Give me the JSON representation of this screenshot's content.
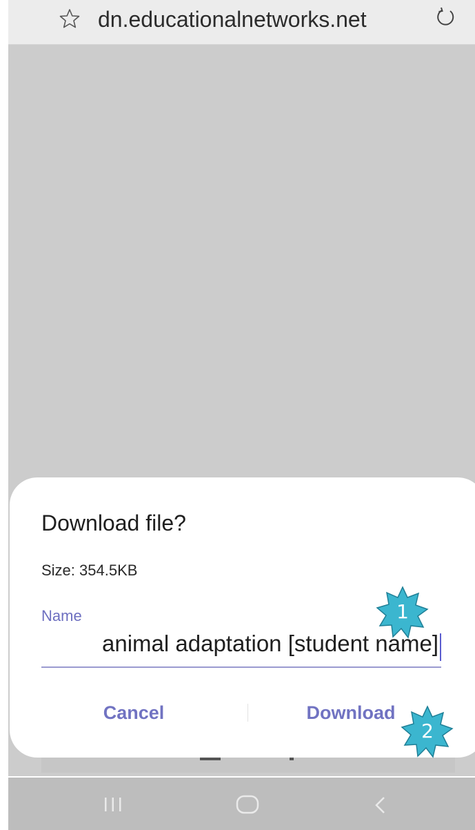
{
  "browser": {
    "url": "dn.educationalnetworks.net",
    "icons": {
      "bookmark": "star-icon",
      "reload": "reload-icon"
    }
  },
  "dialog": {
    "title": "Download file?",
    "size": "Size: 354.5KB",
    "name_label": "Name",
    "name_value": "animal adaptation [student name]",
    "cancel_label": "Cancel",
    "download_label": "Download"
  },
  "annotations": [
    {
      "label": "1"
    },
    {
      "label": "2"
    }
  ],
  "colors": {
    "accent": "#6d6fc0",
    "badge": "#3bb6cf",
    "overlay": "#cccccc"
  },
  "navigation": {
    "icons": [
      "recents-icon",
      "home-icon",
      "back-icon"
    ]
  }
}
